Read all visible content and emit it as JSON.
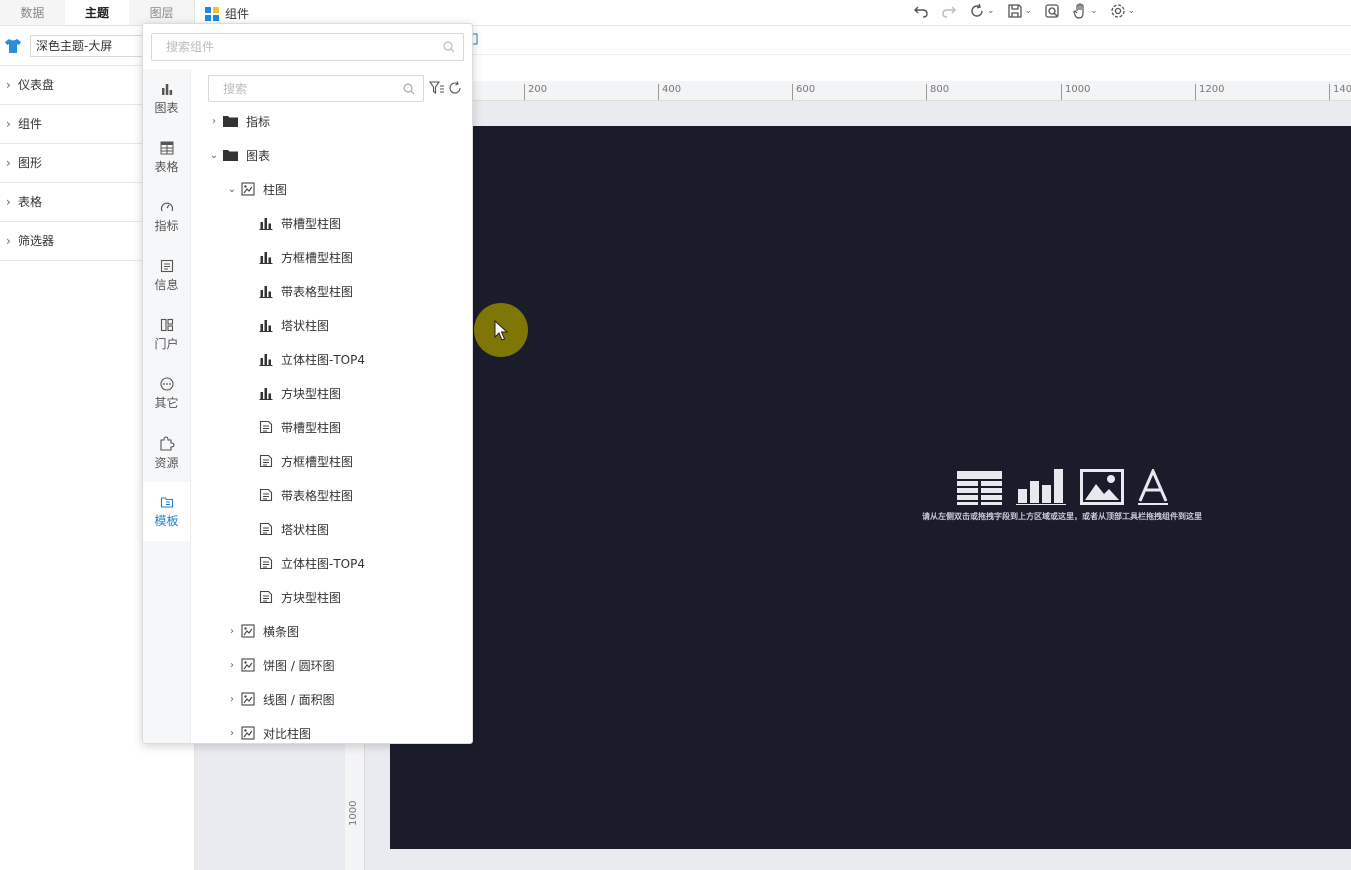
{
  "left_panel": {
    "tabs": [
      {
        "label": "数据",
        "active": false
      },
      {
        "label": "主题",
        "active": true
      },
      {
        "label": "图层",
        "active": false
      }
    ],
    "theme": {
      "value": "深色主题-大屏"
    },
    "sections": [
      {
        "label": "仪表盘"
      },
      {
        "label": "组件"
      },
      {
        "label": "图形"
      },
      {
        "label": "表格"
      },
      {
        "label": "筛选器"
      }
    ]
  },
  "topbar": {
    "title": "组件",
    "icons": [
      "undo-icon",
      "redo-icon",
      "refresh-icon",
      "save-icon",
      "preview-icon",
      "hand-icon",
      "settings-icon"
    ]
  },
  "popup": {
    "search_placeholder": "搜索组件",
    "tree_search_placeholder": "搜索",
    "categories": [
      {
        "label": "图表",
        "icon": "bar-chart-icon",
        "active": false
      },
      {
        "label": "表格",
        "icon": "table-icon",
        "active": false
      },
      {
        "label": "指标",
        "icon": "gauge-icon",
        "active": false
      },
      {
        "label": "信息",
        "icon": "info-icon",
        "active": false
      },
      {
        "label": "门户",
        "icon": "portal-icon",
        "active": false
      },
      {
        "label": "其它",
        "icon": "more-icon",
        "active": false
      },
      {
        "label": "资源",
        "icon": "puzzle-icon",
        "active": false
      },
      {
        "label": "模板",
        "icon": "template-icon",
        "active": true
      }
    ],
    "tree": [
      {
        "label": "指标",
        "level": 0,
        "arrow": "›",
        "icon": "folder"
      },
      {
        "label": "图表",
        "level": 0,
        "arrow": "⌄",
        "icon": "folder"
      },
      {
        "label": "柱图",
        "level": 1,
        "arrow": "⌄",
        "icon": "chart-group"
      },
      {
        "label": "带槽型柱图",
        "level": 2,
        "icon": "bar"
      },
      {
        "label": "方框槽型柱图",
        "level": 2,
        "icon": "bar"
      },
      {
        "label": "带表格型柱图",
        "level": 2,
        "icon": "bar"
      },
      {
        "label": "塔状柱图",
        "level": 2,
        "icon": "bar"
      },
      {
        "label": "立体柱图-TOP4",
        "level": 2,
        "icon": "bar"
      },
      {
        "label": "方块型柱图",
        "level": 2,
        "icon": "bar"
      },
      {
        "label": "带槽型柱图",
        "level": 2,
        "icon": "doc"
      },
      {
        "label": "方框槽型柱图",
        "level": 2,
        "icon": "doc"
      },
      {
        "label": "带表格型柱图",
        "level": 2,
        "icon": "doc"
      },
      {
        "label": "塔状柱图",
        "level": 2,
        "icon": "doc"
      },
      {
        "label": "立体柱图-TOP4",
        "level": 2,
        "icon": "doc"
      },
      {
        "label": "方块型柱图",
        "level": 2,
        "icon": "doc"
      },
      {
        "label": "横条图",
        "level": 1,
        "arrow": "›",
        "icon": "chart-group"
      },
      {
        "label": "饼图 / 圆环图",
        "level": 1,
        "arrow": "›",
        "icon": "chart-group"
      },
      {
        "label": "线图 / 面积图",
        "level": 1,
        "arrow": "›",
        "icon": "chart-group"
      },
      {
        "label": "对比柱图",
        "level": 1,
        "arrow": "›",
        "icon": "chart-group"
      }
    ]
  },
  "canvas": {
    "ruler_h": [
      "200",
      "400",
      "600",
      "800",
      "1000",
      "1200",
      "140"
    ],
    "ruler_v": [
      "1000"
    ],
    "hint": "请从左侧双击或拖拽字段到上方区域或这里，或者从顶部工具栏拖拽组件到这里",
    "bg_color": "#1a1c2c"
  },
  "colors": {
    "accent": "#1a7fd4",
    "cursor_ring": "#968a00"
  }
}
